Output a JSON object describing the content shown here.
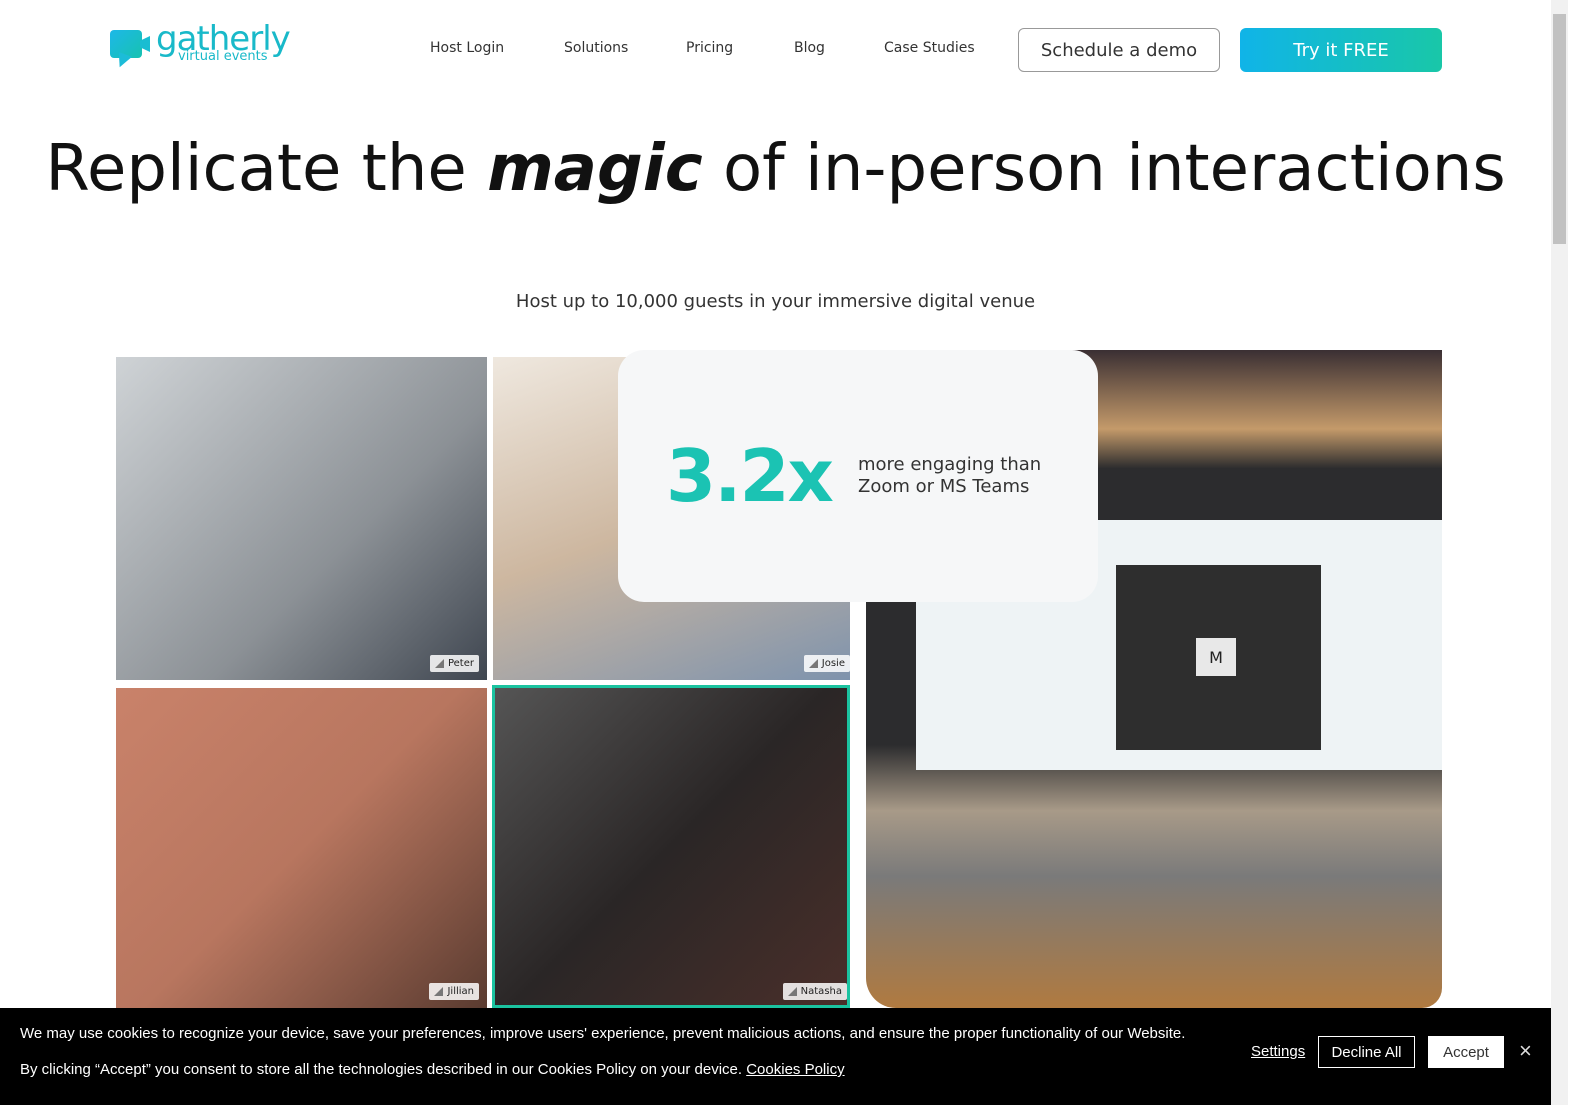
{
  "brand": {
    "name": "gatherly",
    "tagline": "virtual events"
  },
  "nav": {
    "links": [
      "Host Login",
      "Solutions",
      "Pricing",
      "Blog",
      "Case Studies"
    ],
    "demo": "Schedule a demo",
    "try": "Try it FREE"
  },
  "hero": {
    "title_pre": "Replicate the ",
    "title_em": "magic",
    "title_post": " of in-person interactions",
    "subtitle": "Host up to 10,000 guests in your immersive digital venue"
  },
  "stat": {
    "value": "3.2x",
    "text": "more engaging than Zoom or MS Teams"
  },
  "tiles": {
    "peter": "Peter",
    "josie": "Josie",
    "jillian": "Jillian",
    "natasha": "Natasha",
    "laptop_letter": "M"
  },
  "cookie": {
    "line1": "We may use cookies to recognize your device, save your preferences, improve users' experience, prevent malicious actions, and ensure the proper functionality of our Website.",
    "line2": "By clicking “Accept” you consent to store all the technologies described in our Cookies Policy on your device.",
    "policy": "Cookies Policy",
    "settings": "Settings",
    "decline": "Decline All",
    "accept": "Accept",
    "close": "×"
  },
  "colors": {
    "accent": "#1bc3b3",
    "brand": "#19b9c9"
  }
}
